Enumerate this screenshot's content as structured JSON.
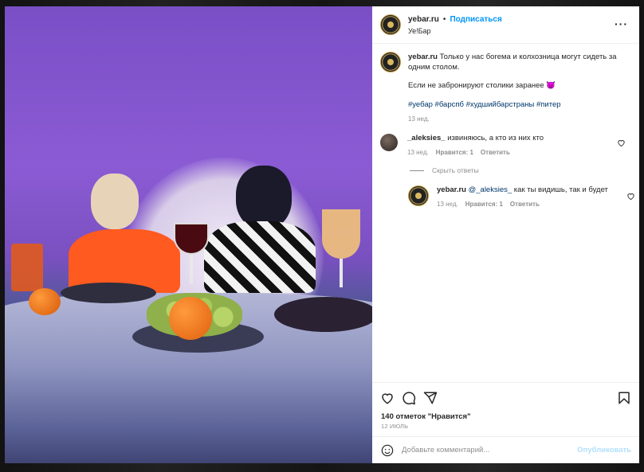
{
  "post": {
    "username": "yebar.ru",
    "separator": "•",
    "follow_label": "Подписаться",
    "location": "Уе!Бар",
    "more_label": "•••"
  },
  "caption": {
    "username": "yebar.ru",
    "text_line1": "Только у нас богема и колхозница могут сидеть за одним столом.",
    "text_line2": "Если не забронируют столики заранее 😈",
    "hashtags": "#уебар #барспб #худшийбарстраны #питер",
    "time": "13 нед."
  },
  "comment": {
    "username": "_aleksies_",
    "text": "извиняюсь, а кто из них кто",
    "time": "13 нед.",
    "likes": "Нравится: 1",
    "reply_label": "Ответить"
  },
  "hide_replies_label": "Скрыть ответы",
  "reply": {
    "username": "yebar.ru",
    "mention": "@_aleksies_",
    "text": "как ты видишь, так и будет",
    "time": "13 нед.",
    "likes": "Нравится: 1",
    "reply_label": "Ответить"
  },
  "stats": {
    "likes_text": "140 отметок \"Нравится\"",
    "date": "12 ИЮЛЬ"
  },
  "add_comment": {
    "placeholder": "Добавьте комментарий...",
    "publish_label": "Опубликовать"
  },
  "icons": {
    "heart": "heart-icon",
    "comment": "comment-icon",
    "share": "share-icon",
    "save": "bookmark-icon",
    "emoji": "emoji-icon",
    "more": "more-icon"
  },
  "colors": {
    "link": "#0095f6",
    "hashtag": "#00376b",
    "muted": "#8e8e8e",
    "publish_disabled": "#b2dffc"
  }
}
